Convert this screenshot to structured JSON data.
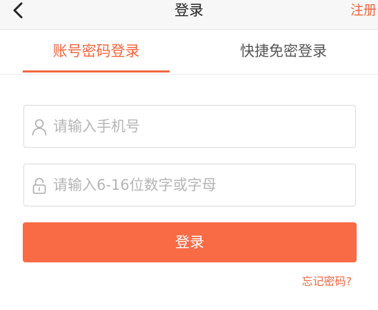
{
  "header": {
    "title": "登录",
    "register_label": "注册",
    "back_icon": "chevron-left-icon"
  },
  "tabs": [
    {
      "label": "账号密码登录",
      "active": true
    },
    {
      "label": "快捷免密登录",
      "active": false
    }
  ],
  "form": {
    "phone": {
      "placeholder": "请输入手机号",
      "value": "",
      "icon": "user-icon"
    },
    "password": {
      "placeholder": "请输入6-16位数字或字母",
      "value": "",
      "icon": "lock-icon"
    },
    "submit_label": "登录",
    "forgot_label": "忘记密码?"
  },
  "colors": {
    "accent": "#f0663c",
    "button": "#f96b44",
    "placeholder": "#b5b5b5",
    "border": "#d9d9d9"
  }
}
